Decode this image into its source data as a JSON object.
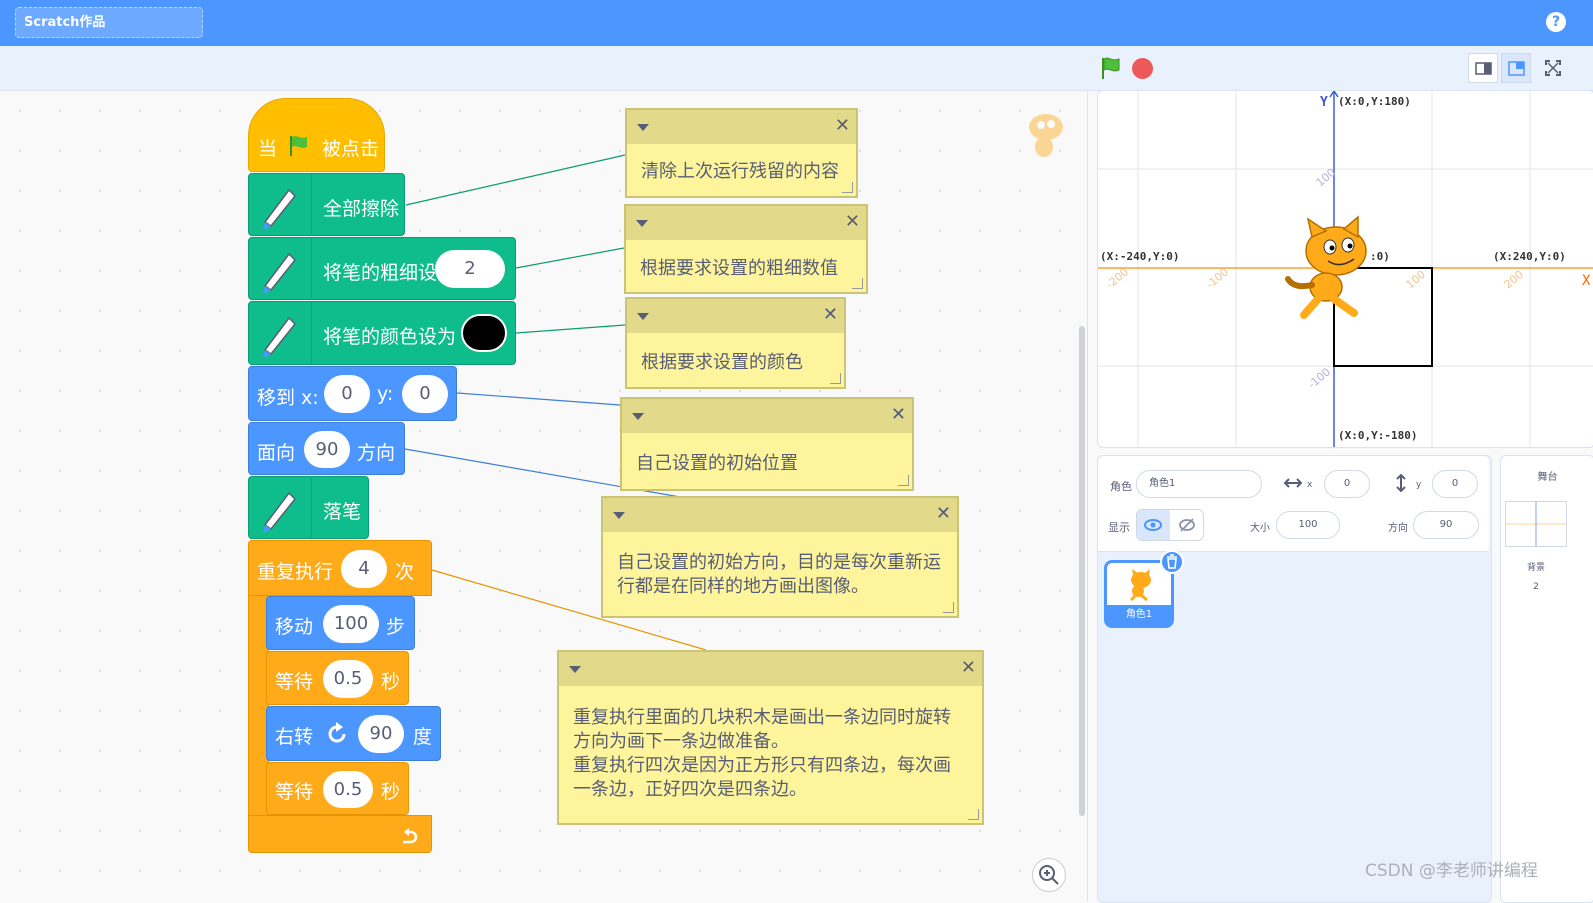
{
  "header": {
    "project_title": "Scratch作品",
    "help_icon": "?"
  },
  "blocks": {
    "hat": {
      "when": "当",
      "clicked": "被点击"
    },
    "clear": {
      "label": "全部擦除"
    },
    "pen_size": {
      "label": "将笔的粗细设为",
      "value": "2"
    },
    "pen_color": {
      "label": "将笔的颜色设为",
      "color": "#000000"
    },
    "goto": {
      "label": "移到 x:",
      "x": "0",
      "y_label": "y:",
      "y": "0"
    },
    "point": {
      "label": "面向",
      "value": "90",
      "suffix": "方向"
    },
    "pen_down": {
      "label": "落笔"
    },
    "repeat": {
      "label": "重复执行",
      "value": "4",
      "suffix": "次"
    },
    "move": {
      "label": "移动",
      "value": "100",
      "suffix": "步"
    },
    "wait1": {
      "label": "等待",
      "value": "0.5",
      "suffix": "秒"
    },
    "turn": {
      "label": "右转",
      "value": "90",
      "suffix": "度"
    },
    "wait2": {
      "label": "等待",
      "value": "0.5",
      "suffix": "秒"
    }
  },
  "comments": [
    {
      "text": "清除上次运行残留的内容"
    },
    {
      "text": "根据要求设置的粗细数值"
    },
    {
      "text": "根据要求设置的颜色"
    },
    {
      "text": "自己设置的初始位置"
    },
    {
      "text": "自己设置的初始方向，目的是每次重新运\n行都是在同样的地方画出图像。"
    },
    {
      "text": "重复执行里面的几块积木是画出一条边同时旋转\n方向为画下一条边做准备。\n重复执行四次是因为正方形只有四条边，每次画\n一条边，正好四次是四条边。"
    }
  ],
  "stage": {
    "y_axis_label": "Y",
    "x_axis_label": "X",
    "top": "(X:0,Y:180)",
    "bottom": "(X:0,Y:-180)",
    "left": "(X:-240,Y:0)",
    "right": "(X:240,Y:0)",
    "origin_partial": ":0)",
    "ticks": {
      "y_pos": "100",
      "y_neg": "-100",
      "x_neg200": "-200",
      "x_neg100": "-100",
      "x_pos100": "100",
      "x_pos200": "200"
    }
  },
  "sprite_info": {
    "sprite_label": "角色",
    "sprite_name": "角色1",
    "x_label": "x",
    "x_value": "0",
    "y_label": "y",
    "y_value": "0",
    "show_label": "显示",
    "size_label": "大小",
    "size_value": "100",
    "direction_label": "方向",
    "direction_value": "90"
  },
  "sprite_list": [
    {
      "name": "角色1"
    }
  ],
  "stage_panel": {
    "title": "舞台",
    "backdrops_label": "背景",
    "backdrops_count": "2"
  },
  "watermark": "CSDN @李老师讲编程",
  "colors": {
    "header": "#4c97ff",
    "pen": "#0fbd8c",
    "motion": "#4c97ff",
    "control": "#ffab19",
    "event": "#ffbf00",
    "note": "#fef49c"
  }
}
